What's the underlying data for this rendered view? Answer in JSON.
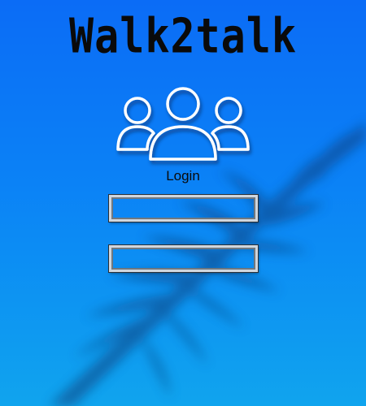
{
  "app": {
    "title": "Walk2talk"
  },
  "login": {
    "label": "Login",
    "username_value": "",
    "password_value": ""
  },
  "icons": {
    "users": "users-group-icon",
    "background": "palm-leaf-shadow"
  },
  "colors": {
    "background_top": "#0b6cf6",
    "background_bottom": "#10a4ee",
    "text": "#0a0a0a",
    "icon_outline": "#ffffff"
  }
}
